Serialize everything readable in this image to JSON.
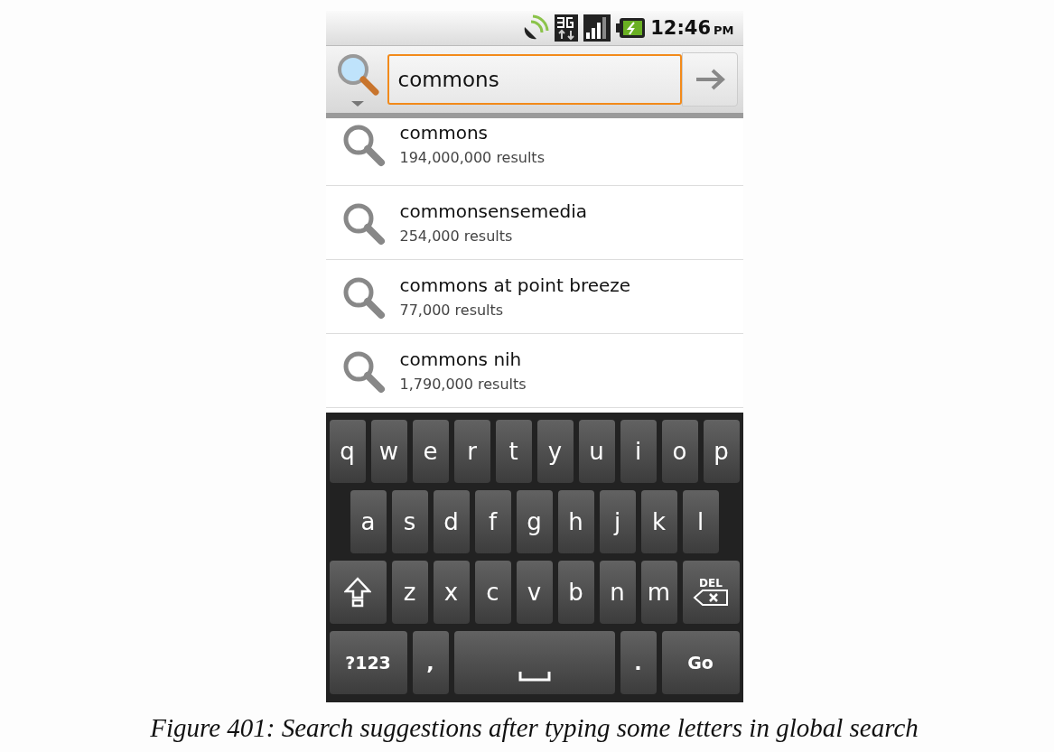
{
  "status_bar": {
    "time": "12:46",
    "meridiem": "PM"
  },
  "search_bar": {
    "value": "commons"
  },
  "suggestions": [
    {
      "title": "commons",
      "subtitle": "194,000,000 results"
    },
    {
      "title": "commonsensemedia",
      "subtitle": "254,000 results"
    },
    {
      "title": "commons at point breeze",
      "subtitle": "77,000 results"
    },
    {
      "title": "commons nih",
      "subtitle": "1,790,000 results"
    }
  ],
  "keyboard": {
    "rows": [
      [
        {
          "kind": "letter",
          "label": "q"
        },
        {
          "kind": "letter",
          "label": "w"
        },
        {
          "kind": "letter",
          "label": "e"
        },
        {
          "kind": "letter",
          "label": "r"
        },
        {
          "kind": "letter",
          "label": "t"
        },
        {
          "kind": "letter",
          "label": "y"
        },
        {
          "kind": "letter",
          "label": "u"
        },
        {
          "kind": "letter",
          "label": "i"
        },
        {
          "kind": "letter",
          "label": "o"
        },
        {
          "kind": "letter",
          "label": "p"
        }
      ],
      [
        {
          "kind": "letter",
          "label": "a"
        },
        {
          "kind": "letter",
          "label": "s"
        },
        {
          "kind": "letter",
          "label": "d"
        },
        {
          "kind": "letter",
          "label": "f"
        },
        {
          "kind": "letter",
          "label": "g"
        },
        {
          "kind": "letter",
          "label": "h"
        },
        {
          "kind": "letter",
          "label": "j"
        },
        {
          "kind": "letter",
          "label": "k"
        },
        {
          "kind": "letter",
          "label": "l"
        }
      ],
      [
        {
          "kind": "shift"
        },
        {
          "kind": "letter",
          "label": "z"
        },
        {
          "kind": "letter",
          "label": "x"
        },
        {
          "kind": "letter",
          "label": "c"
        },
        {
          "kind": "letter",
          "label": "v"
        },
        {
          "kind": "letter",
          "label": "b"
        },
        {
          "kind": "letter",
          "label": "n"
        },
        {
          "kind": "letter",
          "label": "m"
        },
        {
          "kind": "delete",
          "label": "DEL"
        }
      ],
      [
        {
          "kind": "symbols",
          "label": "?123"
        },
        {
          "kind": "punct",
          "label": ","
        },
        {
          "kind": "space"
        },
        {
          "kind": "punct",
          "label": "."
        },
        {
          "kind": "go",
          "label": "Go"
        }
      ]
    ]
  },
  "caption": "Figure 401: Search suggestions after typing some letters in global search"
}
